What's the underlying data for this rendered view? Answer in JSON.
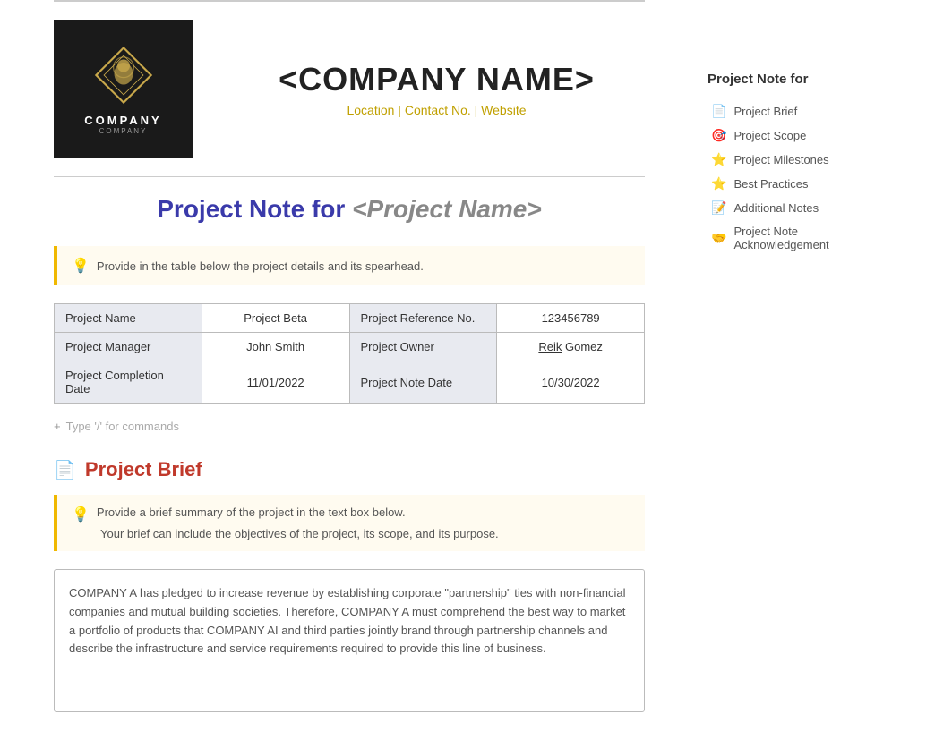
{
  "company": {
    "name": "<COMPANY NAME>",
    "contact_line": "Location | Contact No. | Website",
    "logo_text": "COMPANY",
    "logo_sub": "COMPANY"
  },
  "project": {
    "title_static": "Project Note for",
    "title_dynamic": "<Project Name>",
    "info_hint": "Provide in the table below the project details and its spearhead.",
    "table": {
      "rows": [
        [
          "Project Name",
          "Project Beta",
          "Project Reference No.",
          "123456789"
        ],
        [
          "Project Manager",
          "John Smith",
          "Project Owner",
          "Reik Gomez"
        ],
        [
          "Project Completion Date",
          "11/01/2022",
          "Project Note Date",
          "10/30/2022"
        ]
      ]
    },
    "command_hint": "Type '/' for commands"
  },
  "project_brief": {
    "title": "Project Brief",
    "hint_line1": "Provide a brief summary of the project in the text box below.",
    "hint_line2": "Your brief can include the objectives of the project, its scope, and its purpose.",
    "content": "COMPANY A has pledged to increase revenue by establishing corporate \"partnership\" ties with non-financial companies and mutual building societies. Therefore, COMPANY A must comprehend the best way to market a portfolio of products that COMPANY AI and third parties jointly brand through partnership channels and describe the infrastructure and service requirements required to provide this line of business."
  },
  "sidebar": {
    "title": "Project Note for",
    "items": [
      {
        "icon": "📄",
        "label": "Project Brief"
      },
      {
        "icon": "🎯",
        "label": "Project Scope"
      },
      {
        "icon": "⭐",
        "label": "Project Milestones"
      },
      {
        "icon": "⭐",
        "label": "Best Practices"
      },
      {
        "icon": "📝",
        "label": "Additional Notes"
      },
      {
        "icon": "🤝",
        "label": "Project Note Acknowledgement"
      }
    ]
  }
}
